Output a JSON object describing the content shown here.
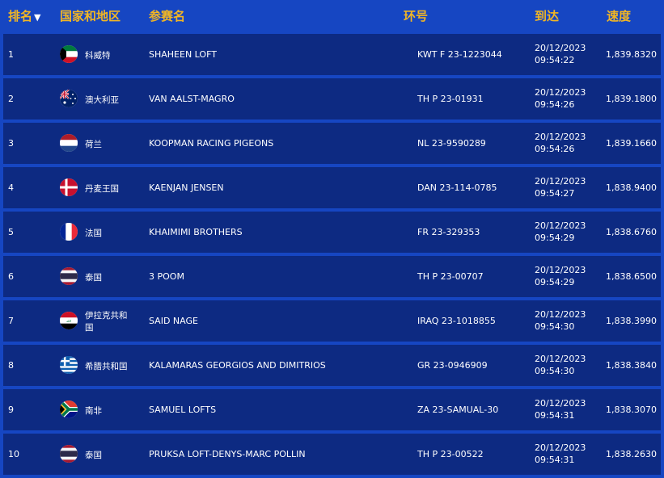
{
  "header": {
    "rank": "排名",
    "country": "国家和地区",
    "name": "参赛名",
    "ring": "环号",
    "arrive": "到达",
    "speed": "速度",
    "sort_icon": "▼"
  },
  "rows": [
    {
      "rank": "1",
      "flag": "kuwait-flag-icon",
      "country": "科威特",
      "name": "SHAHEEN LOFT",
      "ring": "KWT F 23-1223044",
      "date": "20/12/2023",
      "time": "09:54:22",
      "speed": "1,839.8320"
    },
    {
      "rank": "2",
      "flag": "australia-flag-icon",
      "country": "澳大利亚",
      "name": "VAN AALST-MAGRO",
      "ring": "TH P 23-01931",
      "date": "20/12/2023",
      "time": "09:54:26",
      "speed": "1,839.1800"
    },
    {
      "rank": "3",
      "flag": "netherlands-flag-icon",
      "country": "荷兰",
      "name": "KOOPMAN RACING PIGEONS",
      "ring": "NL 23-9590289",
      "date": "20/12/2023",
      "time": "09:54:26",
      "speed": "1,839.1660"
    },
    {
      "rank": "4",
      "flag": "denmark-flag-icon",
      "country": "丹麦王国",
      "name": "KAENJAN JENSEN",
      "ring": "DAN 23-114-0785",
      "date": "20/12/2023",
      "time": "09:54:27",
      "speed": "1,838.9400"
    },
    {
      "rank": "5",
      "flag": "france-flag-icon",
      "country": "法国",
      "name": "KHAIMIMI BROTHERS",
      "ring": "FR 23-329353",
      "date": "20/12/2023",
      "time": "09:54:29",
      "speed": "1,838.6760"
    },
    {
      "rank": "6",
      "flag": "thailand-flag-icon",
      "country": "泰国",
      "name": "3 POOM",
      "ring": "TH P 23-00707",
      "date": "20/12/2023",
      "time": "09:54:29",
      "speed": "1,838.6500"
    },
    {
      "rank": "7",
      "flag": "iraq-flag-icon",
      "country": "伊拉克共和国",
      "name": "SAID NAGE",
      "ring": "IRAQ 23-1018855",
      "date": "20/12/2023",
      "time": "09:54:30",
      "speed": "1,838.3990"
    },
    {
      "rank": "8",
      "flag": "greece-flag-icon",
      "country": "希腊共和国",
      "name": "KALAMARAS GEORGIOS AND DIMITRIOS",
      "ring": "GR 23-0946909",
      "date": "20/12/2023",
      "time": "09:54:30",
      "speed": "1,838.3840"
    },
    {
      "rank": "9",
      "flag": "south-africa-flag-icon",
      "country": "南非",
      "name": "SAMUEL LOFTS",
      "ring": "ZA 23-SAMUAL-30",
      "date": "20/12/2023",
      "time": "09:54:31",
      "speed": "1,838.3070"
    },
    {
      "rank": "10",
      "flag": "thailand-flag-icon",
      "country": "泰国",
      "name": "PRUKSA LOFT-DENYS-MARC POLLIN",
      "ring": "TH P 23-00522",
      "date": "20/12/2023",
      "time": "09:54:31",
      "speed": "1,838.2630"
    }
  ]
}
